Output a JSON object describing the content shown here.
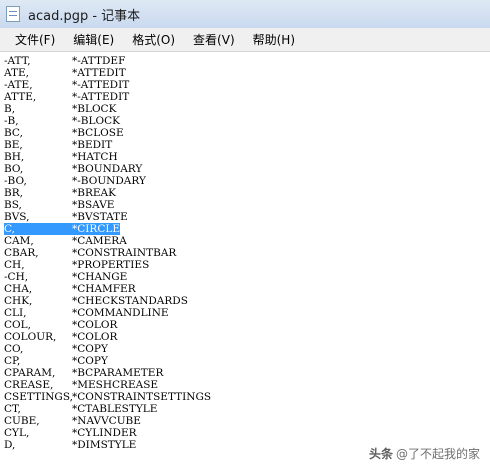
{
  "window": {
    "title": "acad.pgp - 记事本",
    "icon": "notepad-icon"
  },
  "menu": [
    "文件(F)",
    "编辑(E)",
    "格式(O)",
    "查看(V)",
    "帮助(H)"
  ],
  "lines": [
    [
      "-ATT,",
      "*-ATTDEF"
    ],
    [
      "ATE,",
      "*ATTEDIT"
    ],
    [
      "-ATE,",
      "*-ATTEDIT"
    ],
    [
      "ATTE,",
      "*-ATTEDIT"
    ],
    [
      "B,",
      "*BLOCK"
    ],
    [
      "-B,",
      "*-BLOCK"
    ],
    [
      "BC,",
      "*BCLOSE"
    ],
    [
      "BE,",
      "*BEDIT"
    ],
    [
      "BH,",
      "*HATCH"
    ],
    [
      "BO,",
      "*BOUNDARY"
    ],
    [
      "-BO,",
      "*-BOUNDARY"
    ],
    [
      "BR,",
      "*BREAK"
    ],
    [
      "BS,",
      "*BSAVE"
    ],
    [
      "BVS,",
      "*BVSTATE"
    ],
    [
      "C,",
      "*CIRCLE"
    ],
    [
      "CAM,",
      "*CAMERA"
    ],
    [
      "CBAR,",
      "*CONSTRAINTBAR"
    ],
    [
      "CH,",
      "*PROPERTIES"
    ],
    [
      "-CH,",
      "*CHANGE"
    ],
    [
      "CHA,",
      "*CHAMFER"
    ],
    [
      "CHK,",
      "*CHECKSTANDARDS"
    ],
    [
      "CLI,",
      "*COMMANDLINE"
    ],
    [
      "COL,",
      "*COLOR"
    ],
    [
      "COLOUR,",
      "*COLOR"
    ],
    [
      "CO,",
      "*COPY"
    ],
    [
      "CP,",
      "*COPY"
    ],
    [
      "CPARAM,",
      "*BCPARAMETER"
    ],
    [
      "CREASE,",
      "*MESHCREASE"
    ],
    [
      "CSETTINGS,",
      "*CONSTRAINTSETTINGS"
    ],
    [
      "CT,",
      "*CTABLESTYLE"
    ],
    [
      "CUBE,",
      "*NAVVCUBE"
    ],
    [
      "CYL,",
      "*CYLINDER"
    ],
    [
      "D,",
      "*DIMSTYLE"
    ]
  ],
  "selected_line": 14,
  "selection_color": "#3399ff",
  "watermark": {
    "logo": "头条",
    "text": "@了不起我的家"
  }
}
